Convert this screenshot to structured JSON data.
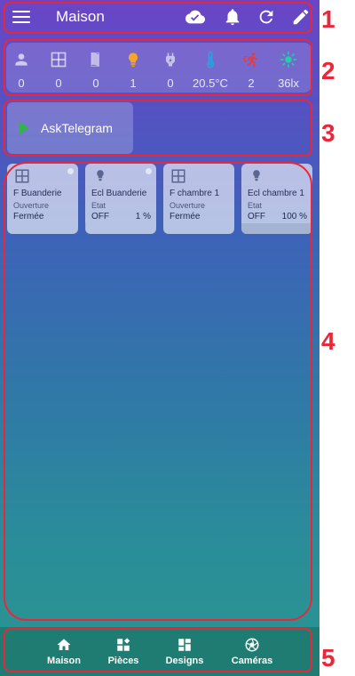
{
  "header": {
    "title": "Maison",
    "icons": [
      "menu-icon",
      "cloud-check-icon",
      "bell-icon",
      "refresh-icon",
      "edit-icon"
    ]
  },
  "status": [
    {
      "icon": "person-icon",
      "value": "0"
    },
    {
      "icon": "window-icon",
      "value": "0"
    },
    {
      "icon": "door-icon",
      "value": "0"
    },
    {
      "icon": "light-bulb-icon",
      "value": "1"
    },
    {
      "icon": "plug-icon",
      "value": "0"
    },
    {
      "icon": "thermometer-icon",
      "value": "20.5°C"
    },
    {
      "icon": "motion-icon",
      "value": "2"
    },
    {
      "icon": "brightness-icon",
      "value": "36lx"
    }
  ],
  "scene": {
    "label": "AskTelegram"
  },
  "cards": [
    {
      "name": "F Buanderie",
      "sub": "Ouverture",
      "value": "Fermée",
      "pct": ""
    },
    {
      "name": "Ecl Buanderie",
      "sub": "Etat",
      "value": "OFF",
      "pct": "1 %",
      "level": 0.01
    },
    {
      "name": "F chambre 1",
      "sub": "Ouverture",
      "value": "Fermée",
      "pct": ""
    },
    {
      "name": "Ecl chambre 1",
      "sub": "Etat",
      "value": "OFF",
      "pct": "100 %",
      "level": 1.0
    }
  ],
  "nav": [
    {
      "label": "Maison",
      "icon": "home-icon"
    },
    {
      "label": "Pièces",
      "icon": "rooms-icon"
    },
    {
      "label": "Designs",
      "icon": "designs-icon"
    },
    {
      "label": "Caméras",
      "icon": "camera-icon"
    }
  ],
  "annotations": [
    "1",
    "2",
    "3",
    "4",
    "5"
  ],
  "colors": {
    "annotation": "#e8283a",
    "light_on": "#f5a623",
    "thermometer": "#2d9ee0",
    "motion": "#e83a3a",
    "brightness": "#1fd0a8",
    "scene_play": "#33b34a"
  }
}
